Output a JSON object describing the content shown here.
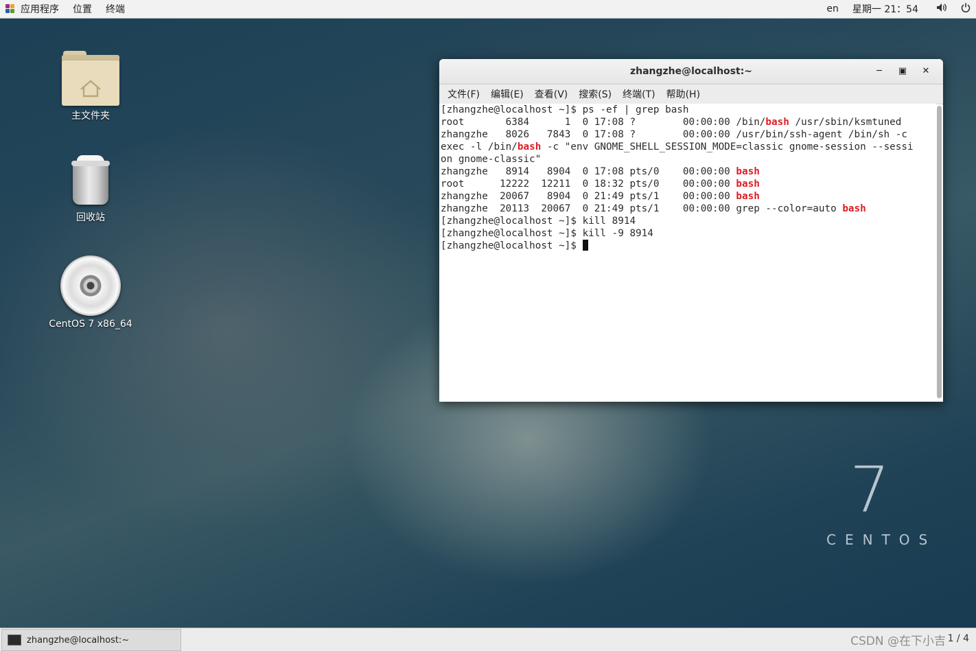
{
  "top_panel": {
    "applications": "应用程序",
    "places": "位置",
    "terminal": "终端",
    "language": "en",
    "clock": "星期一 21：54"
  },
  "desktop": {
    "icons": [
      {
        "label": "主文件夹",
        "icon": "home-folder-icon"
      },
      {
        "label": "回收站",
        "icon": "trash-icon"
      },
      {
        "label": "CentOS 7 x86_64",
        "icon": "optical-disc-icon"
      }
    ],
    "branding_seven": "7",
    "branding_word": "CENTOS"
  },
  "terminal": {
    "title": "zhangzhe@localhost:~",
    "menu": [
      "文件(F)",
      "编辑(E)",
      "查看(V)",
      "搜索(S)",
      "终端(T)",
      "帮助(H)"
    ],
    "lines": [
      [
        {
          "t": "[zhangzhe@localhost ~]$ ps -ef | grep bash"
        }
      ],
      [
        {
          "t": "root       6384      1  0 17:08 ?        00:00:00 /bin/"
        },
        {
          "t": "bash",
          "hl": true
        },
        {
          "t": " /usr/sbin/ksmtuned"
        }
      ],
      [
        {
          "t": "zhangzhe   8026   7843  0 17:08 ?        00:00:00 /usr/bin/ssh-agent /bin/sh -c"
        }
      ],
      [
        {
          "t": "exec -l /bin/"
        },
        {
          "t": "bash",
          "hl": true
        },
        {
          "t": " -c \"env GNOME_SHELL_SESSION_MODE=classic gnome-session --sessi"
        }
      ],
      [
        {
          "t": "on gnome-classic\""
        }
      ],
      [
        {
          "t": "zhangzhe   8914   8904  0 17:08 pts/0    00:00:00 "
        },
        {
          "t": "bash",
          "hl": true
        }
      ],
      [
        {
          "t": "root      12222  12211  0 18:32 pts/0    00:00:00 "
        },
        {
          "t": "bash",
          "hl": true
        }
      ],
      [
        {
          "t": "zhangzhe  20067   8904  0 21:49 pts/1    00:00:00 "
        },
        {
          "t": "bash",
          "hl": true
        }
      ],
      [
        {
          "t": "zhangzhe  20113  20067  0 21:49 pts/1    00:00:00 grep --color=auto "
        },
        {
          "t": "bash",
          "hl": true
        }
      ],
      [
        {
          "t": "[zhangzhe@localhost ~]$ kill 8914"
        }
      ],
      [
        {
          "t": "[zhangzhe@localhost ~]$ kill -9 8914"
        }
      ],
      [
        {
          "t": "[zhangzhe@localhost ~]$ "
        },
        {
          "cursor": true
        }
      ]
    ]
  },
  "taskbar": {
    "window_label": "zhangzhe@localhost:~",
    "watermark": "CSDN @在下小吉",
    "workspace": "1 / 4"
  },
  "colors": {
    "highlight": "#e01b24",
    "panel_bg": "#f2f2f2"
  }
}
